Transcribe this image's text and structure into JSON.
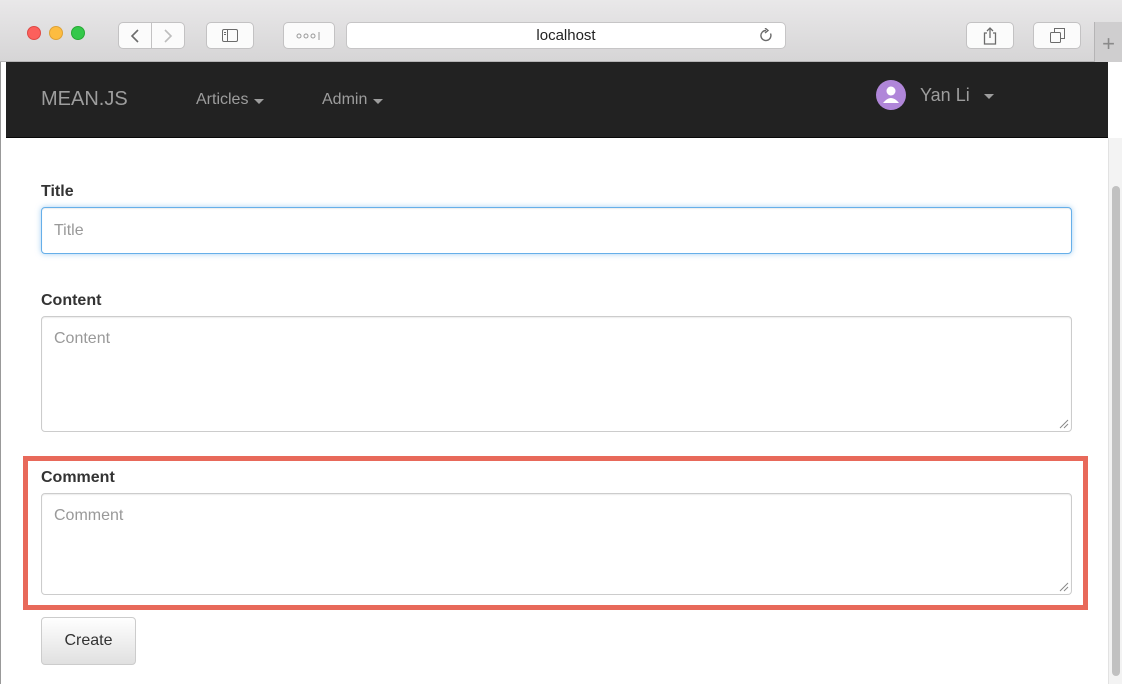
{
  "browser": {
    "address": "localhost",
    "new_tab_label": "+"
  },
  "navbar": {
    "brand": "MEAN.JS",
    "menus": [
      {
        "label": "Articles"
      },
      {
        "label": "Admin"
      }
    ],
    "user": {
      "name": "Yan Li"
    }
  },
  "form": {
    "title": {
      "label": "Title",
      "placeholder": "Title"
    },
    "content": {
      "label": "Content",
      "placeholder": "Content"
    },
    "comment": {
      "label": "Comment",
      "placeholder": "Comment"
    },
    "submit_label": "Create"
  },
  "colors": {
    "navbar_bg": "#222222",
    "highlight": "#e8695a",
    "focus": "#66afe9",
    "avatar": "#b086d9"
  }
}
